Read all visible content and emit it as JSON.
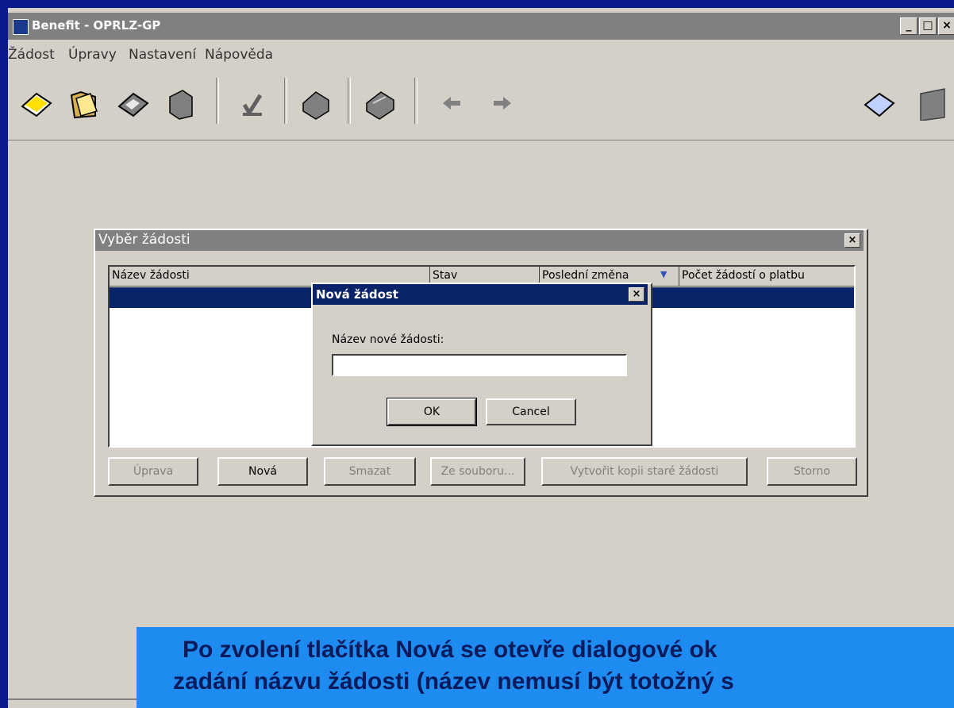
{
  "window": {
    "title": "Benefit - OPRLZ-GP"
  },
  "menu": [
    "Žádost",
    "Úpravy",
    "Nastavení",
    "Nápověda"
  ],
  "window_controls": [
    "_",
    "□",
    "×"
  ],
  "toolbar_icons": [
    "open-card-icon",
    "folder-icon",
    "card-icon",
    "cube-icon",
    "check-icon",
    "printer-icon",
    "fax-icon",
    "arrow-left-icon",
    "arrow-right-icon",
    "help-card-icon",
    "book-icon"
  ],
  "dialog": {
    "title": "Vyběr žádosti",
    "close": "×",
    "columns": [
      "Název žádosti",
      "Stav",
      "Poslední změna",
      "Počet žádostí o platbu"
    ],
    "sort_indicator": "▼",
    "buttons": {
      "edit": "Úprava",
      "new": "Nová",
      "delete": "Smazat",
      "from_file": "Ze souboru...",
      "copy_old": "Vytvořit kopii staré žádosti",
      "cancel": "Storno"
    }
  },
  "modal": {
    "title": "Nová žádost",
    "close": "×",
    "field_label": "Název nové žádosti:",
    "field_value": "",
    "ok": "OK",
    "cancel": "Cancel"
  },
  "caption": {
    "line1": "Po zvolení tlačítka Nová se otevře dialogové ok",
    "line2": "zadání názvu žádosti (název nemusí být totožný s"
  }
}
